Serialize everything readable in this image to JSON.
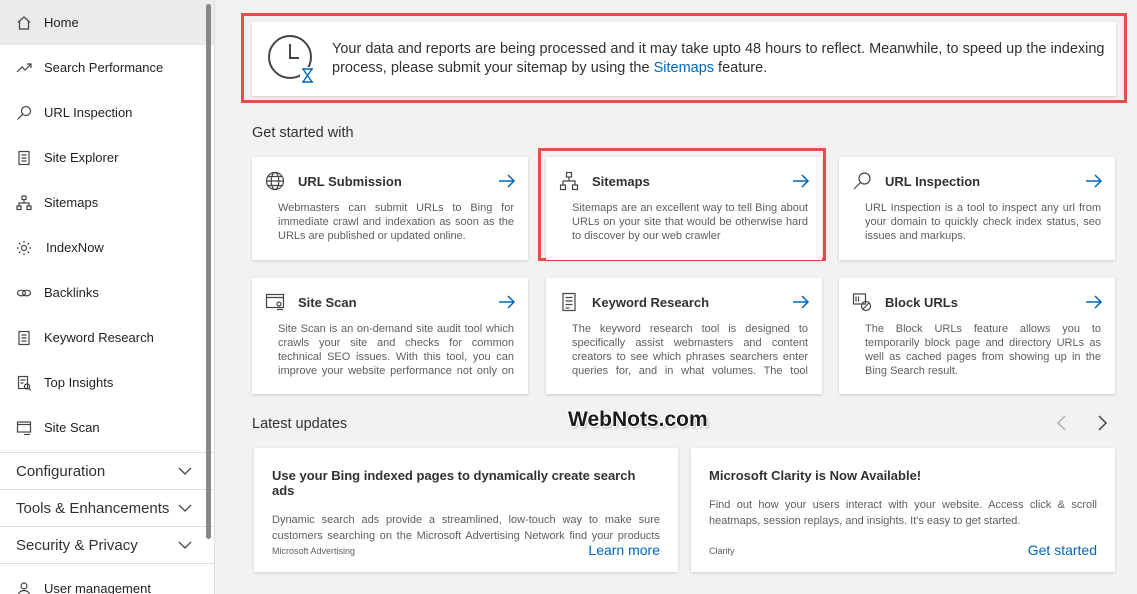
{
  "sidebar": {
    "items": [
      {
        "label": "Home",
        "icon": "home-icon"
      },
      {
        "label": "Search Performance",
        "icon": "trend-icon"
      },
      {
        "label": "URL Inspection",
        "icon": "magnifier-icon"
      },
      {
        "label": "Site Explorer",
        "icon": "document-icon"
      },
      {
        "label": "Sitemaps",
        "icon": "sitemap-icon"
      },
      {
        "label": "IndexNow",
        "icon": "gear-icon"
      },
      {
        "label": "Backlinks",
        "icon": "link-icon"
      },
      {
        "label": "Keyword Research",
        "icon": "document-icon"
      },
      {
        "label": "Top Insights",
        "icon": "insights-icon"
      },
      {
        "label": "Site Scan",
        "icon": "scan-icon"
      }
    ],
    "sections": [
      {
        "label": "Configuration"
      },
      {
        "label": "Tools & Enhancements"
      },
      {
        "label": "Security & Privacy"
      }
    ],
    "bottom_item": {
      "label": "User management",
      "icon": "user-icon"
    }
  },
  "notice": {
    "text_before": "Your data and reports are being processed and it may take upto 48 hours to reflect. Meanwhile, to speed up the indexing process, please submit your sitemap by using the ",
    "link": "Sitemaps",
    "text_after": " feature."
  },
  "get_started": {
    "title": "Get started with",
    "cards": [
      {
        "title": "URL Submission",
        "icon": "globe-icon",
        "desc": "Webmasters can submit URLs to Bing for immediate crawl and indexation as soon as the URLs are published or updated online."
      },
      {
        "title": "Sitemaps",
        "icon": "sitemap-icon",
        "desc": "Sitemaps are an excellent way to tell Bing about URLs on your site that would be otherwise hard to discover by our web crawler"
      },
      {
        "title": "URL Inspection",
        "icon": "magnifier-icon",
        "desc": "URL Inspection is a tool to inspect any url from your domain to quickly check index status, seo issues and markups."
      },
      {
        "title": "Site Scan",
        "icon": "scan-icon",
        "desc": "Site Scan is an on-demand site audit tool which crawls your site and checks for common technical SEO issues. With this tool, you can improve your website performance not only on Bing but on…"
      },
      {
        "title": "Keyword Research",
        "icon": "document-icon",
        "desc": "The keyword research tool is designed to specifically assist webmasters and content creators to see which phrases searchers enter queries for, and in what volumes. The tool uses…"
      },
      {
        "title": "Block URLs",
        "icon": "block-icon",
        "desc": "The Block URLs feature allows you to temporarily block page and directory URLs as well as cached pages from showing up in the Bing Search result."
      }
    ]
  },
  "latest_updates": {
    "title": "Latest updates",
    "items": [
      {
        "title": "Use your Bing indexed pages to dynamically create search ads",
        "desc": "Dynamic search ads provide a streamlined, low-touch way to make sure customers searching on the Microsoft Advertising Network find your products or…",
        "source": "Microsoft Advertising",
        "link": "Learn more"
      },
      {
        "title": "Microsoft Clarity is Now Available!",
        "desc": "Find out how your users interact with your website. Access click & scroll heatmaps, session replays, and insights. It's easy to get started.",
        "source": "Clarity",
        "link": "Get started"
      }
    ]
  },
  "watermark": "WebNots.com",
  "colors": {
    "accent": "#0067b8",
    "highlight": "#e0514d"
  }
}
